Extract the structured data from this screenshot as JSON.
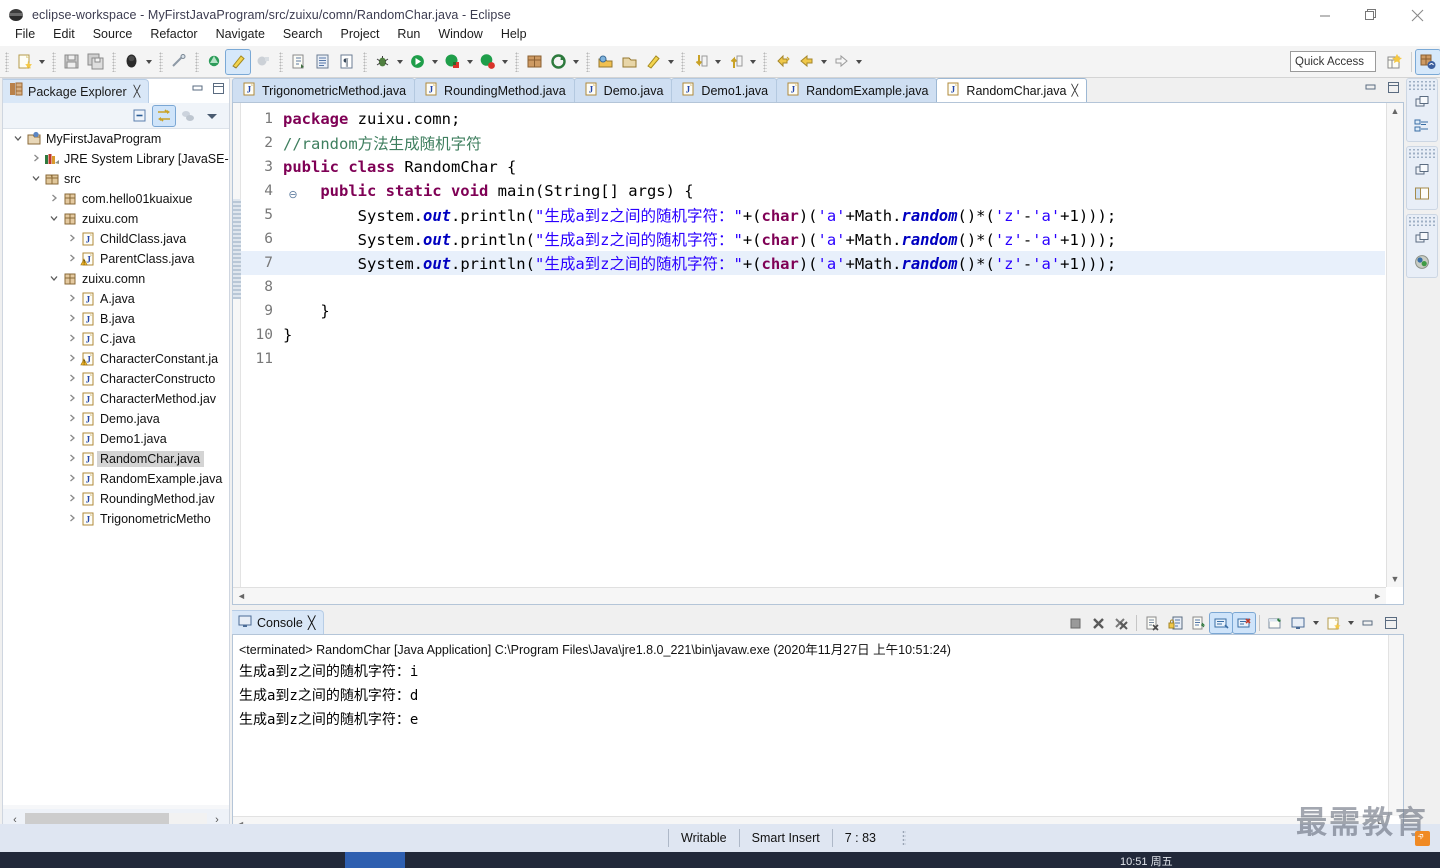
{
  "window": {
    "title": "eclipse-workspace - MyFirstJavaProgram/src/zuixu/comn/RandomChar.java - Eclipse",
    "minimize": "—",
    "maximize": "❐",
    "close": "✕"
  },
  "menubar": {
    "items": [
      "File",
      "Edit",
      "Source",
      "Refactor",
      "Navigate",
      "Search",
      "Project",
      "Run",
      "Window",
      "Help"
    ]
  },
  "toolbar": {
    "quick_access_placeholder": "Quick Access",
    "icons": [
      "new-wizard-icon",
      "save-icon",
      "save-all-icon",
      "print-icon",
      "toggle-mark-occurrences-icon",
      "new-java-package-icon",
      "new-java-class-icon",
      "open-type-icon",
      "new-annotation-icon",
      "open-task-icon",
      "show-whitespace-icon",
      "debug-icon",
      "run-icon",
      "run-coverage-icon",
      "external-tools-icon",
      "new-java-project-icon",
      "search-icon",
      "open-resource-icon",
      "skip-breakpoints-icon",
      "next-annotation-icon",
      "previous-annotation-icon",
      "last-edit-location-icon",
      "back-icon",
      "forward-icon"
    ]
  },
  "explorer": {
    "tab_label": "Package Explorer",
    "tab_close": "╳",
    "tools": [
      "collapse-all-icon",
      "link-with-editor-icon",
      "focus-on-active-task-icon",
      "view-menu-icon"
    ],
    "tree": [
      {
        "label": "MyFirstJavaProgram",
        "indent": 0,
        "arrow": "v",
        "icon": "java-project-icon",
        "selected": false
      },
      {
        "label": "JRE System Library [JavaSE-",
        "indent": 1,
        "arrow": ">",
        "icon": "library-icon",
        "selected": false
      },
      {
        "label": "src",
        "indent": 1,
        "arrow": "v",
        "icon": "source-folder-icon",
        "selected": false
      },
      {
        "label": "com.hello01kuaixue",
        "indent": 2,
        "arrow": ">",
        "icon": "package-icon",
        "selected": false
      },
      {
        "label": "zuixu.com",
        "indent": 2,
        "arrow": "v",
        "icon": "package-icon",
        "selected": false
      },
      {
        "label": "ChildClass.java",
        "indent": 3,
        "arrow": ">",
        "icon": "java-file-icon",
        "selected": false
      },
      {
        "label": "ParentClass.java",
        "indent": 3,
        "arrow": ">",
        "icon": "java-file-warning-icon",
        "selected": false
      },
      {
        "label": "zuixu.comn",
        "indent": 2,
        "arrow": "v",
        "icon": "package-icon",
        "selected": false
      },
      {
        "label": "A.java",
        "indent": 3,
        "arrow": ">",
        "icon": "java-file-icon",
        "selected": false
      },
      {
        "label": "B.java",
        "indent": 3,
        "arrow": ">",
        "icon": "java-file-icon",
        "selected": false
      },
      {
        "label": "C.java",
        "indent": 3,
        "arrow": ">",
        "icon": "java-file-icon",
        "selected": false
      },
      {
        "label": "CharacterConstant.ja",
        "indent": 3,
        "arrow": ">",
        "icon": "java-file-warning-icon",
        "selected": false
      },
      {
        "label": "CharacterConstructo",
        "indent": 3,
        "arrow": ">",
        "icon": "java-file-icon",
        "selected": false
      },
      {
        "label": "CharacterMethod.jav",
        "indent": 3,
        "arrow": ">",
        "icon": "java-file-icon",
        "selected": false
      },
      {
        "label": "Demo.java",
        "indent": 3,
        "arrow": ">",
        "icon": "java-file-icon",
        "selected": false
      },
      {
        "label": "Demo1.java",
        "indent": 3,
        "arrow": ">",
        "icon": "java-file-icon",
        "selected": false
      },
      {
        "label": "RandomChar.java",
        "indent": 3,
        "arrow": ">",
        "icon": "java-file-icon",
        "selected": true
      },
      {
        "label": "RandomExample.java",
        "indent": 3,
        "arrow": ">",
        "icon": "java-file-icon",
        "selected": false
      },
      {
        "label": "RoundingMethod.jav",
        "indent": 3,
        "arrow": ">",
        "icon": "java-file-icon",
        "selected": false
      },
      {
        "label": "TrigonometricMetho",
        "indent": 3,
        "arrow": ">",
        "icon": "java-file-icon",
        "selected": false
      }
    ],
    "hscroll": {
      "left_arrow": "‹",
      "right_arrow": "›"
    }
  },
  "editor": {
    "tabs": [
      {
        "label": "TrigonometricMethod.java",
        "active": false,
        "close": ""
      },
      {
        "label": "RoundingMethod.java",
        "active": false,
        "close": ""
      },
      {
        "label": "Demo.java",
        "active": false,
        "close": ""
      },
      {
        "label": "Demo1.java",
        "active": false,
        "close": ""
      },
      {
        "label": "RandomExample.java",
        "active": false,
        "close": ""
      },
      {
        "label": "RandomChar.java",
        "active": true,
        "close": "╳"
      }
    ],
    "lines": [
      {
        "n": "1",
        "fold": "",
        "highlight": false,
        "segments": [
          {
            "t": "package ",
            "c": "kw"
          },
          {
            "t": "zuixu.comn;",
            "c": "plain"
          }
        ]
      },
      {
        "n": "2",
        "fold": "",
        "highlight": false,
        "segments": [
          {
            "t": "//random方法生成随机字符",
            "c": "cmt"
          }
        ]
      },
      {
        "n": "3",
        "fold": "",
        "highlight": false,
        "segments": [
          {
            "t": "public class ",
            "c": "kw"
          },
          {
            "t": "RandomChar {",
            "c": "plain"
          }
        ]
      },
      {
        "n": "4",
        "fold": "⊖",
        "highlight": false,
        "segments": [
          {
            "t": "    ",
            "c": "plain"
          },
          {
            "t": "public static void ",
            "c": "kw"
          },
          {
            "t": "main(String[] args) {",
            "c": "plain"
          }
        ]
      },
      {
        "n": "5",
        "fold": "",
        "highlight": false,
        "segments": [
          {
            "t": "        System.",
            "c": "plain"
          },
          {
            "t": "out",
            "c": "fld"
          },
          {
            "t": ".println(",
            "c": "plain"
          },
          {
            "t": "\"生成a到z之间的随机字符：\"",
            "c": "str"
          },
          {
            "t": "+(",
            "c": "plain"
          },
          {
            "t": "char",
            "c": "kw"
          },
          {
            "t": ")(",
            "c": "plain"
          },
          {
            "t": "'a'",
            "c": "str"
          },
          {
            "t": "+Math.",
            "c": "plain"
          },
          {
            "t": "random",
            "c": "fld"
          },
          {
            "t": "()*(",
            "c": "plain"
          },
          {
            "t": "'z'",
            "c": "str"
          },
          {
            "t": "-",
            "c": "plain"
          },
          {
            "t": "'a'",
            "c": "str"
          },
          {
            "t": "+1)));",
            "c": "plain"
          }
        ]
      },
      {
        "n": "6",
        "fold": "",
        "highlight": false,
        "segments": [
          {
            "t": "        System.",
            "c": "plain"
          },
          {
            "t": "out",
            "c": "fld"
          },
          {
            "t": ".println(",
            "c": "plain"
          },
          {
            "t": "\"生成a到z之间的随机字符：\"",
            "c": "str"
          },
          {
            "t": "+(",
            "c": "plain"
          },
          {
            "t": "char",
            "c": "kw"
          },
          {
            "t": ")(",
            "c": "plain"
          },
          {
            "t": "'a'",
            "c": "str"
          },
          {
            "t": "+Math.",
            "c": "plain"
          },
          {
            "t": "random",
            "c": "fld"
          },
          {
            "t": "()*(",
            "c": "plain"
          },
          {
            "t": "'z'",
            "c": "str"
          },
          {
            "t": "-",
            "c": "plain"
          },
          {
            "t": "'a'",
            "c": "str"
          },
          {
            "t": "+1)));",
            "c": "plain"
          }
        ]
      },
      {
        "n": "7",
        "fold": "",
        "highlight": true,
        "segments": [
          {
            "t": "        System.",
            "c": "plain"
          },
          {
            "t": "out",
            "c": "fld"
          },
          {
            "t": ".println(",
            "c": "plain"
          },
          {
            "t": "\"生成a到z之间的随机字符：\"",
            "c": "str"
          },
          {
            "t": "+(",
            "c": "plain"
          },
          {
            "t": "char",
            "c": "kw"
          },
          {
            "t": ")(",
            "c": "plain"
          },
          {
            "t": "'a'",
            "c": "str"
          },
          {
            "t": "+Math.",
            "c": "plain"
          },
          {
            "t": "random",
            "c": "fld"
          },
          {
            "t": "()*(",
            "c": "plain"
          },
          {
            "t": "'z'",
            "c": "str"
          },
          {
            "t": "-",
            "c": "plain"
          },
          {
            "t": "'a'",
            "c": "str"
          },
          {
            "t": "+1)));",
            "c": "plain"
          }
        ]
      },
      {
        "n": "8",
        "fold": "",
        "highlight": false,
        "segments": [
          {
            "t": "",
            "c": "plain"
          }
        ]
      },
      {
        "n": "9",
        "fold": "",
        "highlight": false,
        "segments": [
          {
            "t": "    }",
            "c": "plain"
          }
        ]
      },
      {
        "n": "10",
        "fold": "",
        "highlight": false,
        "segments": [
          {
            "t": "}",
            "c": "plain"
          }
        ]
      },
      {
        "n": "11",
        "fold": "",
        "highlight": false,
        "segments": [
          {
            "t": "",
            "c": "plain"
          }
        ]
      }
    ]
  },
  "console": {
    "tab_label": "Console",
    "tab_close": "╳",
    "terminated_line": "<terminated> RandomChar [Java Application] C:\\Program Files\\Java\\jre1.8.0_221\\bin\\javaw.exe (2020年11月27日 上午10:51:24)",
    "output": [
      "生成a到z之间的随机字符：i",
      "生成a到z之间的随机字符：d",
      "生成a到z之间的随机字符：e"
    ],
    "tools": [
      "terminate-icon",
      "remove-launch-icon",
      "remove-all-terminated-icon",
      "clear-console-icon",
      "scroll-lock-icon",
      "word-wrap-icon",
      "show-console-on-output-icon",
      "show-console-on-error-icon",
      "pin-console-icon",
      "display-selected-console-icon",
      "open-console-icon",
      "minimize-icon",
      "maximize-icon"
    ]
  },
  "rail": {
    "groups": [
      [
        "restore-icon",
        "outline-view-icon"
      ],
      [
        "restore-icon",
        "package-explorer-view-icon"
      ],
      [
        "restore-icon",
        "java-perspective-icon"
      ]
    ]
  },
  "statusbar": {
    "writable": "Writable",
    "insert_mode": "Smart Insert",
    "position": "7 : 83"
  },
  "watermark": {
    "text": "最需教育"
  },
  "taskbar": {
    "clock": "10:51 周五"
  }
}
